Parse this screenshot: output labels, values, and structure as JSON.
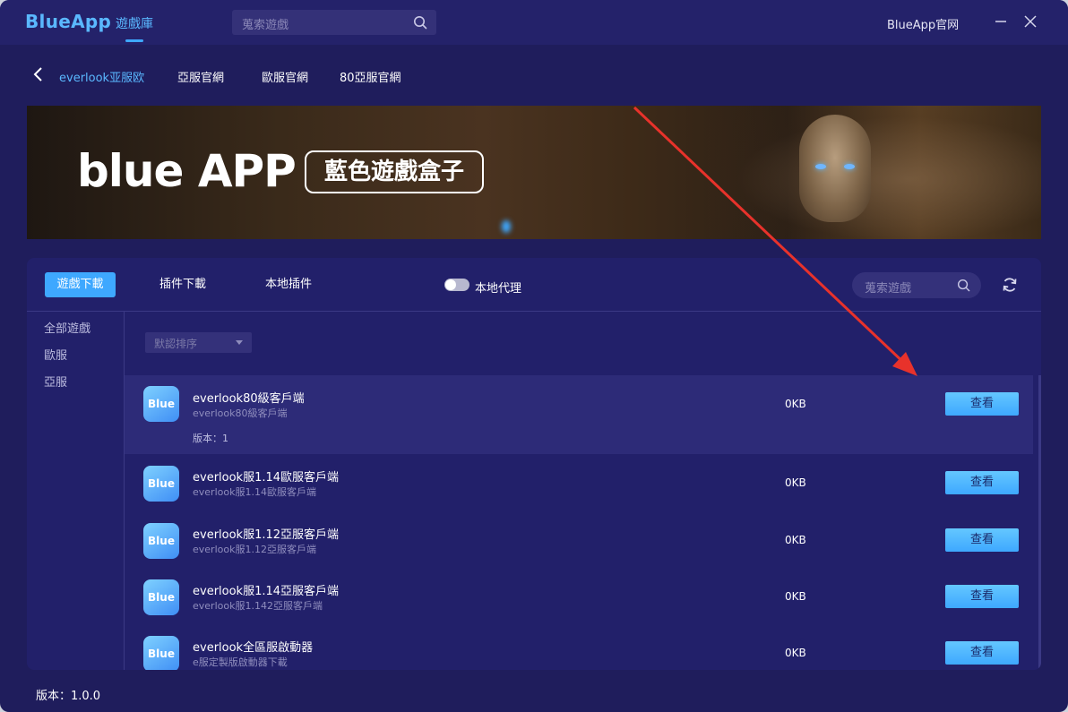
{
  "app": {
    "logo": "BlueApp",
    "nav_library": "遊戲庫",
    "search_placeholder": "蒐索遊戲",
    "official_site": "BlueApp官网"
  },
  "subnav": {
    "items": [
      {
        "label": "everlook亚服欧",
        "active": true
      },
      {
        "label": "亞服官網"
      },
      {
        "label": "歐服官網"
      },
      {
        "label": "80亞服官網"
      }
    ]
  },
  "banner": {
    "brand": "blue APP",
    "tagline": "藍色遊戲盒子"
  },
  "panel": {
    "tabs": [
      {
        "label": "遊戲下載",
        "active": true
      },
      {
        "label": "插件下載"
      },
      {
        "label": "本地插件"
      }
    ],
    "proxy_label": "本地代理",
    "search_placeholder": "蒐索遊戲",
    "sidebar": [
      "全部遊戲",
      "歐服",
      "亞服"
    ],
    "sort_label": "默認排序",
    "rows": [
      {
        "title": "everlook80級客戶端",
        "subtitle": "everlook80級客戶端",
        "version": "版本：1",
        "size": "0KB",
        "button": "查看"
      },
      {
        "title": "everlook服1.14歐服客戶端",
        "subtitle": "everlook服1.14歐服客戶端",
        "size": "0KB",
        "button": "查看"
      },
      {
        "title": "everlook服1.12亞服客戶端",
        "subtitle": "everlook服1.12亞服客戶端",
        "size": "0KB",
        "button": "查看"
      },
      {
        "title": "everlook服1.14亞服客戶端",
        "subtitle": "everlook服1.142亞服客戶端",
        "size": "0KB",
        "button": "查看"
      },
      {
        "title": "everlook全區服啟動器",
        "subtitle": "e服定製版啟動器下載",
        "size": "0KB",
        "button": "查看"
      }
    ],
    "icon_text": "Blue"
  },
  "footer": {
    "version": "版本：1.0.0"
  },
  "colors": {
    "accent": "#3ea8ff",
    "window_bg": "#1f1d5c",
    "panel_bg": "#22206a",
    "arrow": "#e8322b"
  }
}
